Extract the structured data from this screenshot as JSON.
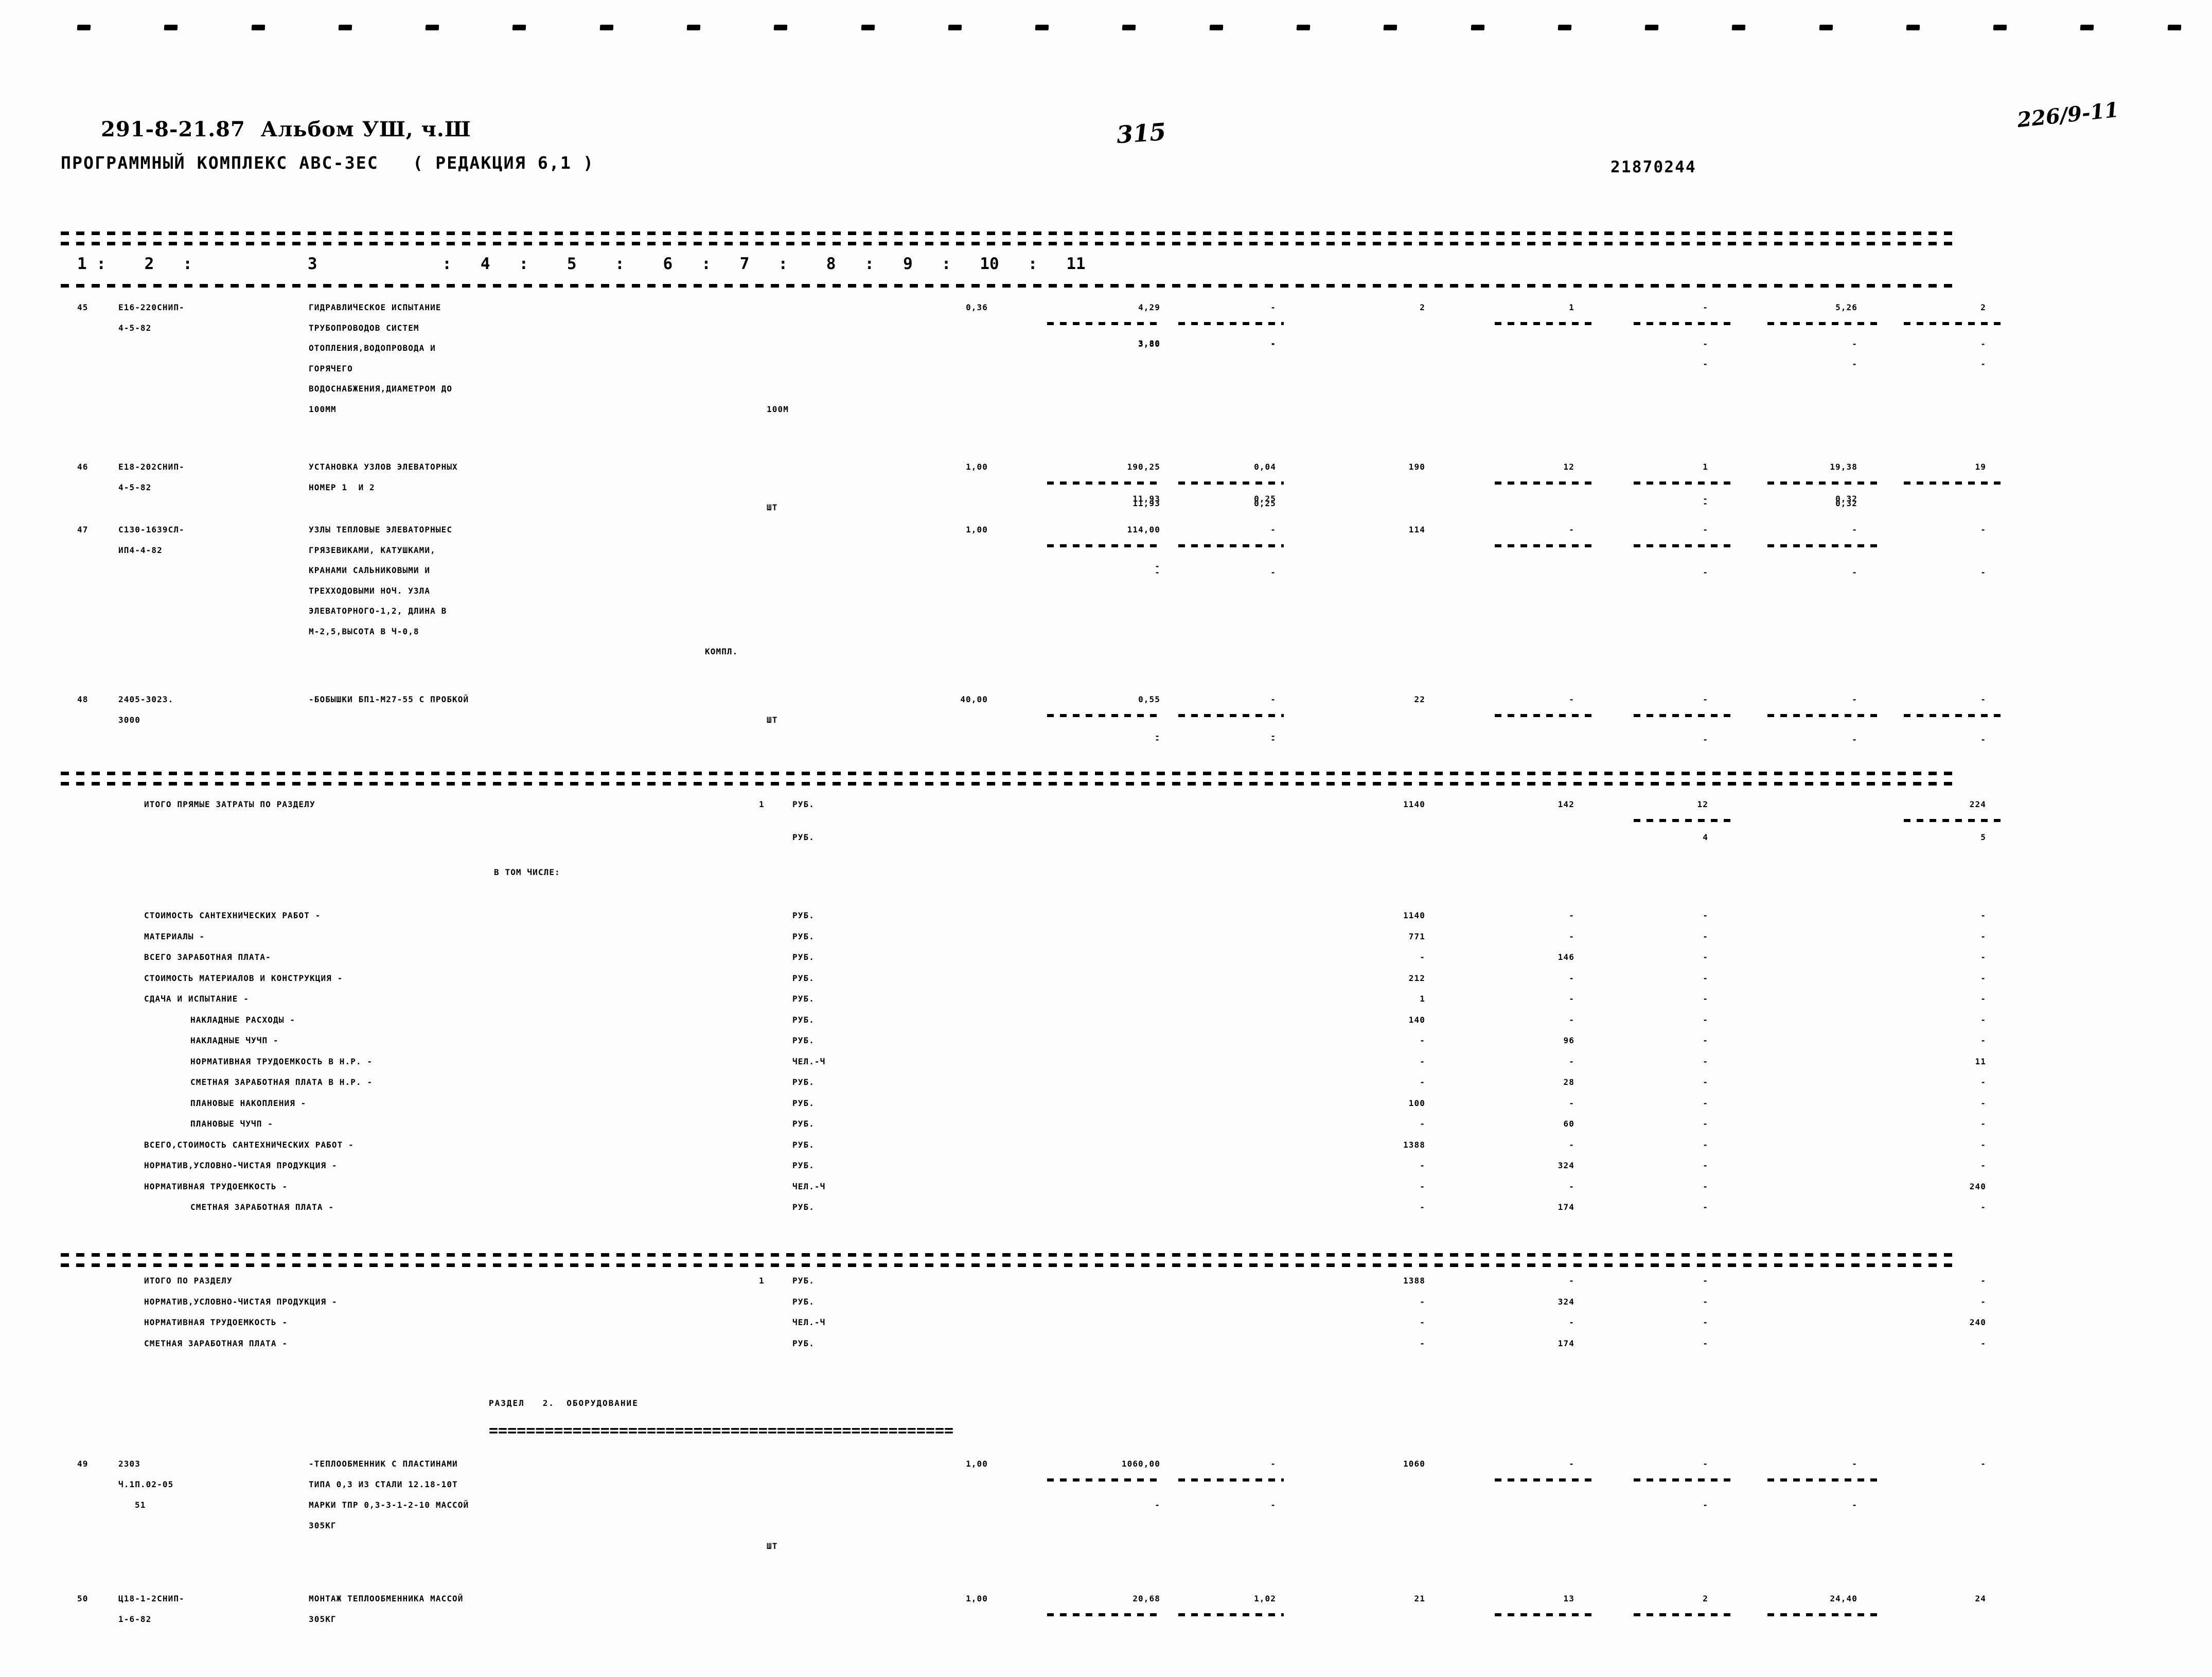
{
  "document": {
    "header_line1": "291-8-21.87  Альбом УШ, ч.Ш",
    "header_line2": "ПРОГРАММНЫЙ КОМПЛЕКС АВС-3ЕС   ( РЕДАКЦИЯ 6,1 )",
    "page_number_handwritten": "315",
    "archive_code_handwritten": "226/9-11",
    "run_id": "21870244"
  },
  "table": {
    "column_header": "1 :    2   :            3             :   4   :    5    :    6   :   7   :    8   :   9   :   10   :   11",
    "rows": [
      {
        "no": "45",
        "code": "Е16-220СНИП-",
        "code2": "4-5-82",
        "desc": [
          "ГИДРАВЛИЧЕСКОЕ ИСПЫТАНИЕ",
          "ТРУБОПРОВОДОВ СИСТЕМ",
          "ОТОПЛЕНИЯ,ВОДОПРОВОДА И",
          "ГОРЯЧЕГО",
          "ВОДОСНАБЖЕНИЯ,ДИАМЕТРОМ ДО",
          "100ММ"
        ],
        "unit": "100М",
        "c4": "0,36",
        "c5": "4,29",
        "c5b": "3,80",
        "c6": "-",
        "c6b": "-",
        "c7": "2",
        "c8": "1",
        "c9": "-",
        "c9b": "-",
        "c10": "5,26",
        "c10b": "-",
        "c11": "2",
        "c11b": "-"
      },
      {
        "no": "46",
        "code": "Е18-202СНИП-",
        "code2": "4-5-82",
        "desc": [
          "УСТАНОВКА УЗЛОВ ЭЛЕВАТОРНЫХ",
          "НОМЕР 1  И 2"
        ],
        "unit": "ШТ",
        "c4": "1,00",
        "c5": "190,25",
        "c5b": "11,93",
        "c6": "0,04",
        "c6b": "0,25",
        "c7": "190",
        "c8": "12",
        "c9": "1",
        "c9b": "-",
        "c10": "19,38",
        "c10b": "0,32",
        "c11": "19"
      },
      {
        "no": "47",
        "code": "С130-1639СЛ-",
        "code2": "ИП4-4-82",
        "desc": [
          "УЗЛЫ ТЕПЛОВЫЕ ЭЛЕВАТОРНЫЕС",
          "ГРЯЗЕВИКАМИ, КАТУШКАМИ,",
          "КРАНАМИ САЛЬНИКОВЫМИ И",
          "ТРЕХХОДОВЫМИ НОЧ. УЗЛА",
          "ЭЛЕВАТОРНОГО-1,2, ДЛИНА В",
          "М-2,5,ВЫСОТА В Ч-0,8"
        ],
        "unit": "КОМПЛ.",
        "c4": "1,00",
        "c5": "114,00",
        "c5b": "-",
        "c6": "-",
        "c7": "114",
        "c8": "-",
        "c9": "-",
        "c10": "-",
        "c11": "-"
      },
      {
        "no": "48",
        "code": "2405-3023.",
        "code2": "3000",
        "desc": [
          "-БОБЫШКИ БП1-М27-55 С ПРОБКОЙ"
        ],
        "unit": "ШТ",
        "c4": "40,00",
        "c5": "0,55",
        "c5b": "-",
        "c6": "-",
        "c6b": "-",
        "c7": "22",
        "c8": "-",
        "c9": "-",
        "c10": "-",
        "c11": "-"
      }
    ],
    "totals_direct": {
      "label": "ИТОГО ПРЯМЫЕ ЗАТРАТЫ ПО РАЗДЕЛУ",
      "section_no": "1",
      "unit1": "РУБ.",
      "unit2": "РУБ.",
      "c7": "1140",
      "c8": "142",
      "c9": "12",
      "c9b": "4",
      "c11": "224",
      "c11b": "5"
    },
    "inclusive_label": "В ТОМ ЧИСЛЕ:",
    "breakdown": [
      {
        "label": "СТОИМОСТЬ САНТЕХНИЧЕСКИХ РАБОТ -",
        "unit": "РУБ.",
        "indent": 0,
        "c7": "1140",
        "c8": "-",
        "c9": "-",
        "c11": "-"
      },
      {
        "label": "МАТЕРИАЛЫ -",
        "unit": "РУБ.",
        "indent": 0,
        "c7": "771",
        "c8": "-",
        "c9": "-",
        "c11": "-"
      },
      {
        "label": "ВСЕГО ЗАРАБОТНАЯ ПЛАТА-",
        "unit": "РУБ.",
        "indent": 0,
        "c7": "-",
        "c8": "146",
        "c9": "-",
        "c11": "-"
      },
      {
        "label": "СТОИМОСТЬ МАТЕРИАЛОВ И КОНСТРУКЦИЯ -",
        "unit": "РУБ.",
        "indent": 0,
        "c7": "212",
        "c8": "-",
        "c9": "-",
        "c11": "-"
      },
      {
        "label": "СДАЧА И ИСПЫТАНИЕ -",
        "unit": "РУБ.",
        "indent": 0,
        "c7": "1",
        "c8": "-",
        "c9": "-",
        "c11": "-"
      },
      {
        "label": "НАКЛАДНЫЕ РАСХОДЫ -",
        "unit": "РУБ.",
        "indent": 1,
        "c7": "140",
        "c8": "-",
        "c9": "-",
        "c11": "-"
      },
      {
        "label": "НАКЛАДНЫЕ ЧУЧП -",
        "unit": "РУБ.",
        "indent": 1,
        "c7": "-",
        "c8": "96",
        "c9": "-",
        "c11": "-"
      },
      {
        "label": "НОРМАТИВНАЯ ТРУДОЕМКОСТЬ В Н.Р. -",
        "unit": "ЧЕЛ.-Ч",
        "indent": 1,
        "c7": "-",
        "c8": "-",
        "c9": "-",
        "c11": "11"
      },
      {
        "label": "СМЕТНАЯ ЗАРАБОТНАЯ ПЛАТА В Н.Р. -",
        "unit": "РУБ.",
        "indent": 1,
        "c7": "-",
        "c8": "28",
        "c9": "-",
        "c11": "-"
      },
      {
        "label": "ПЛАНОВЫЕ НАКОПЛЕНИЯ -",
        "unit": "РУБ.",
        "indent": 1,
        "c7": "100",
        "c8": "-",
        "c9": "-",
        "c11": "-"
      },
      {
        "label": "ПЛАНОВЫЕ ЧУЧП -",
        "unit": "РУБ.",
        "indent": 1,
        "c7": "-",
        "c8": "60",
        "c9": "-",
        "c11": "-"
      },
      {
        "label": "ВСЕГО,СТОИМОСТЬ САНТЕХНИЧЕСКИХ РАБОТ -",
        "unit": "РУБ.",
        "indent": 0,
        "c7": "1388",
        "c8": "-",
        "c9": "-",
        "c11": "-"
      },
      {
        "label": "НОРМАТИВ,УСЛОВНО-ЧИСТАЯ ПРОДУКЦИЯ -",
        "unit": "РУБ.",
        "indent": 0,
        "c7": "-",
        "c8": "324",
        "c9": "-",
        "c11": "-"
      },
      {
        "label": "НОРМАТИВНАЯ ТРУДОЕМКОСТЬ -",
        "unit": "ЧЕЛ.-Ч",
        "indent": 0,
        "c7": "-",
        "c8": "-",
        "c9": "-",
        "c11": "240"
      },
      {
        "label": "СМЕТНАЯ ЗАРАБОТНАЯ ПЛАТА -",
        "unit": "РУБ.",
        "indent": 1,
        "c7": "-",
        "c8": "174",
        "c9": "-",
        "c11": "-"
      }
    ],
    "section_totals": [
      {
        "label": "ИТОГО ПО РАЗДЕЛУ",
        "section_no": "1",
        "unit": "РУБ.",
        "c7": "1388",
        "c8": "-",
        "c9": "-",
        "c11": "-"
      },
      {
        "label": "НОРМАТИВ,УСЛОВНО-ЧИСТАЯ ПРОДУКЦИЯ -",
        "unit": "РУБ.",
        "c7": "-",
        "c8": "324",
        "c9": "-",
        "c11": "-"
      },
      {
        "label": "НОРМАТИВНАЯ ТРУДОЕМКОСТЬ -",
        "unit": "ЧЕЛ.-Ч",
        "c7": "-",
        "c8": "-",
        "c9": "-",
        "c11": "240"
      },
      {
        "label": "СМЕТНАЯ ЗАРАБОТНАЯ ПЛАТА -",
        "unit": "РУБ.",
        "c7": "-",
        "c8": "174",
        "c9": "-",
        "c11": "-"
      }
    ],
    "section2": {
      "title": "РАЗДЕЛ   2.  ОБОРУДОВАНИЕ",
      "rule": "=================================================="
    },
    "rows2": [
      {
        "no": "49",
        "code": "2303",
        "code2": "Ч.1П.02-05",
        "code3": "51",
        "desc": [
          "-ТЕПЛООБМЕННИК С ПЛАСТИНАМИ",
          "ТИПА 0,3 ИЗ СТАЛИ 12.18-10Т",
          "МАРКИ ТПР 0,3-3-1-2-10 МАССОЙ",
          "305КГ"
        ],
        "unit": "ШТ",
        "c4": "1,00",
        "c5": "1060,00",
        "c5b": "-",
        "c6": "-",
        "c6b": "-",
        "c7": "1060",
        "c8": "-",
        "c9": "-",
        "c9b": "-",
        "c10": "-",
        "c10b": "-",
        "c11": "-"
      },
      {
        "no": "50",
        "code": "Ц18-1-2СНИП-",
        "code2": "1-6-82",
        "desc": [
          "МОНТАЖ ТЕПЛООБМЕННИКА МАССОЙ",
          "305КГ"
        ],
        "unit": "",
        "c4": "1,00",
        "c5": "20,68",
        "c6": "1,02",
        "c7": "21",
        "c8": "13",
        "c9": "2",
        "c10": "24,40",
        "c11": "24"
      }
    ]
  }
}
